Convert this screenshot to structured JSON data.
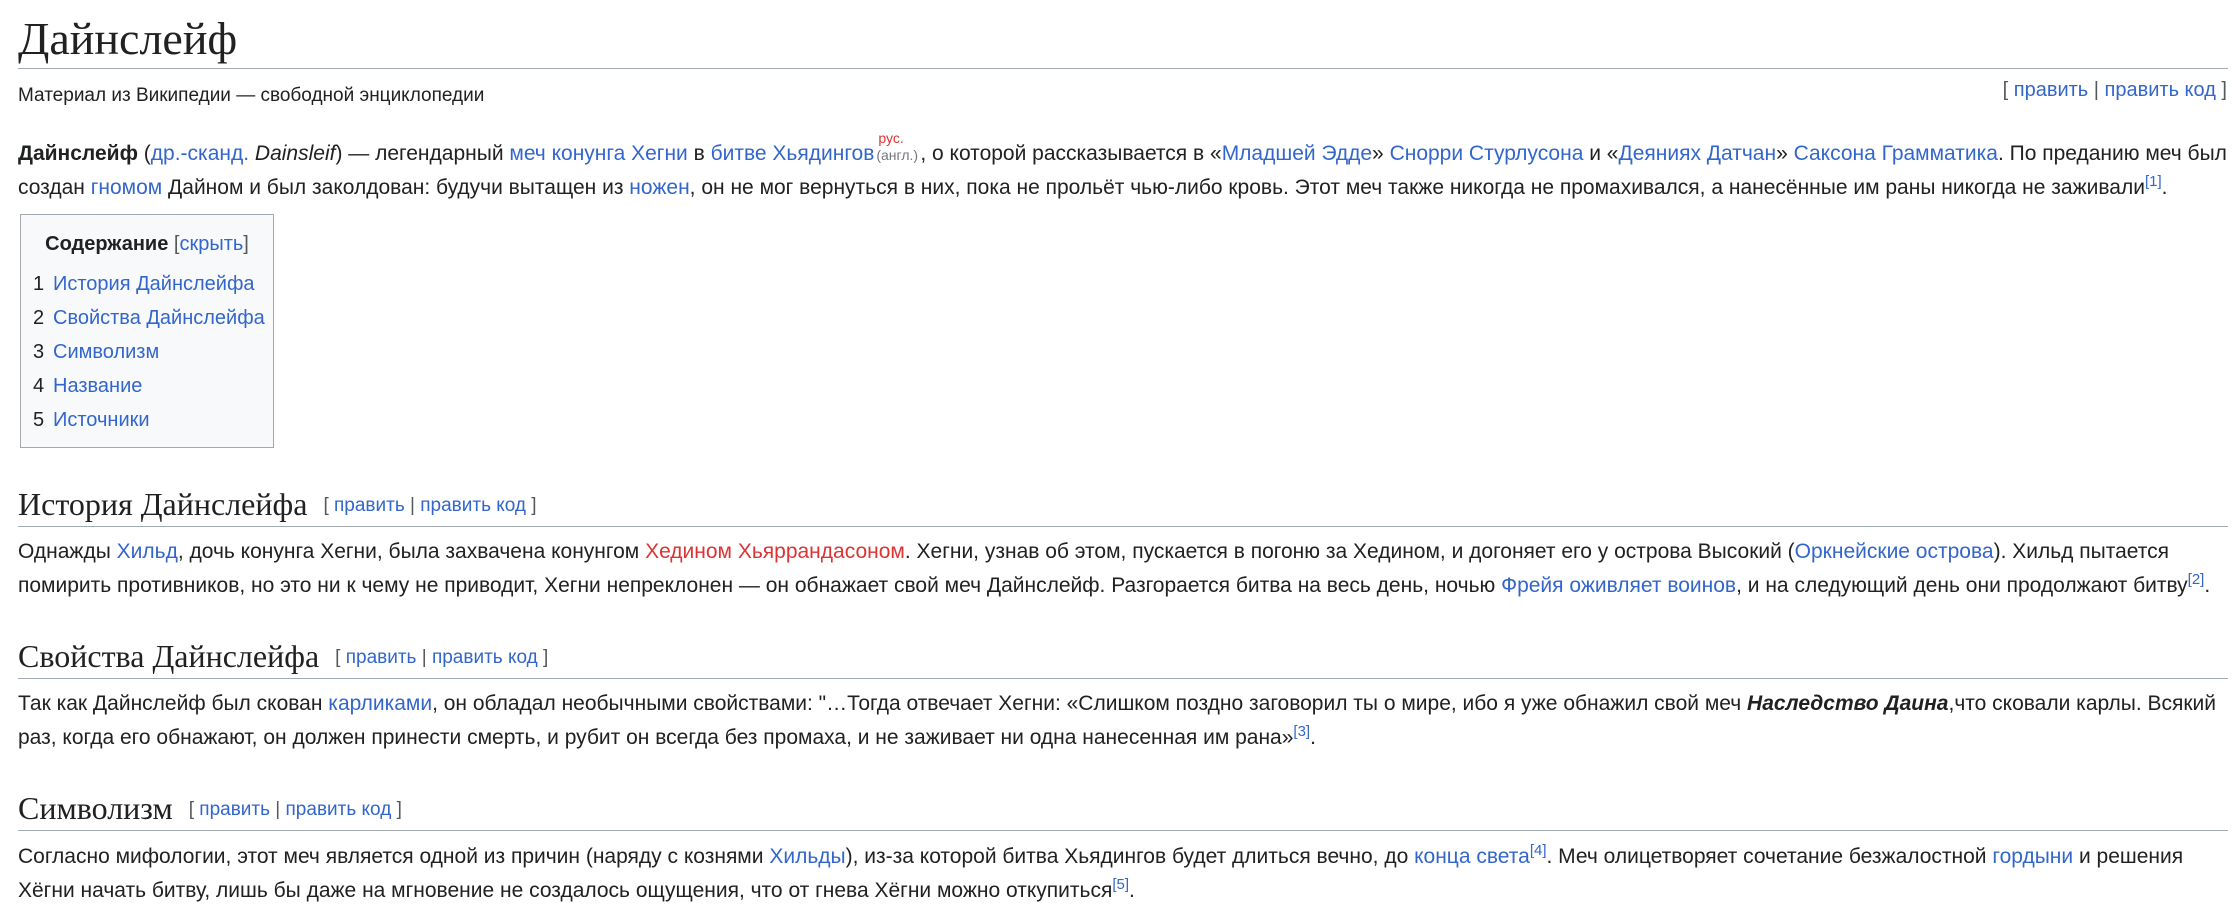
{
  "article": {
    "title": "Дайнслейф",
    "tagline": "Материал из Википедии — свободной энциклопедии",
    "edit": "править",
    "edit_code": "править код"
  },
  "intro": {
    "term": "Дайнслейф",
    "open_paren": " (",
    "lang_link": "др.-сканд.",
    "native_name": "Dainsleif",
    "t1": ") — легендарный ",
    "link_sword": "меч конунга Хегни",
    "t2": " в ",
    "link_battle": "битве Хьядингов",
    "tag_rus": "рус.",
    "tag_eng": "(англ.)",
    "t3": ", о которой рассказывается в «",
    "link_edda": "Младшей Эдде",
    "t4": "» ",
    "link_snorri": "Снорри Стурлусона",
    "t5": " и «",
    "link_deeds": "Деяниях Датчан",
    "t6": "» ",
    "link_saxo": "Саксона Грамматика",
    "t7": ". По преданию меч был создан ",
    "link_gnome": "гномом",
    "t8": " Дайном и был заколдован: будучи вытащен из ",
    "link_sheath": "ножен",
    "t9": ", он не мог вернуться в них, пока не прольёт чью-либо кровь. Этот меч также никогда не промахивался, а нанесённые им раны никогда не заживали",
    "ref": "[1]",
    "t10": "."
  },
  "toc": {
    "title": "Содержание",
    "toggle": "скрыть",
    "items": [
      {
        "num": "1",
        "label": "История Дайнслейфа"
      },
      {
        "num": "2",
        "label": "Свойства Дайнслейфа"
      },
      {
        "num": "3",
        "label": "Символизм"
      },
      {
        "num": "4",
        "label": "Название"
      },
      {
        "num": "5",
        "label": "Источники"
      }
    ]
  },
  "s1": {
    "heading": "История Дайнслейфа",
    "t1": "Однажды ",
    "link_hild": "Хильд",
    "t2": ", дочь конунга Хегни, была захвачена конунгом ",
    "link_hedin": "Хедином Хьяррандасоном",
    "t3": ". Хегни, узнав об этом, пускается в погоню за Хедином, и догоняет его у острова Высокий (",
    "link_orkney": "Оркнейские острова",
    "t4": "). Хильд пытается помирить противников, но это ни к чему не приводит, Хегни непреклонен — он обнажает свой меч Дайнслейф. Разгорается битва на весь день, ночью ",
    "link_freya": "Фрейя оживляет воинов",
    "t5": ", и на следующий день они продолжают битву",
    "ref": "[2]",
    "t6": "."
  },
  "s2": {
    "heading": "Свойства Дайнслейфа",
    "t1": "Так как Дайнслейф был скован ",
    "link_dwarves": "карликами",
    "t2": ", он обладал необычными свойствами: \"…Тогда отвечает Хегни: «Слишком поздно заговорил ты о мире, ибо я уже обнажил свой меч ",
    "emph": "Наследство Даина",
    "t3": ",что сковали карлы. Всякий раз, когда его обнажают, он должен принести смерть, и рубит он всегда без промаха, и не заживает ни одна нанесенная им рана»",
    "ref": "[3]",
    "t4": "."
  },
  "s3": {
    "heading": "Символизм",
    "t1": "Согласно мифологии, этот меч является одной из причин (наряду с кознями ",
    "link_hildy": "Хильды",
    "t2": "), из-за которой битва Хьядингов будет длиться вечно, до ",
    "link_end": "конца света",
    "ref4": "[4]",
    "t3": ". Меч олицетворяет сочетание безжалостной ",
    "link_pride": "гордыни",
    "t4": " и решения Хёгни начать битву, лишь бы даже на мгновение не создалось ощущения, что от гнева Хёгни можно откупиться",
    "ref5": "[5]",
    "t5": "."
  }
}
